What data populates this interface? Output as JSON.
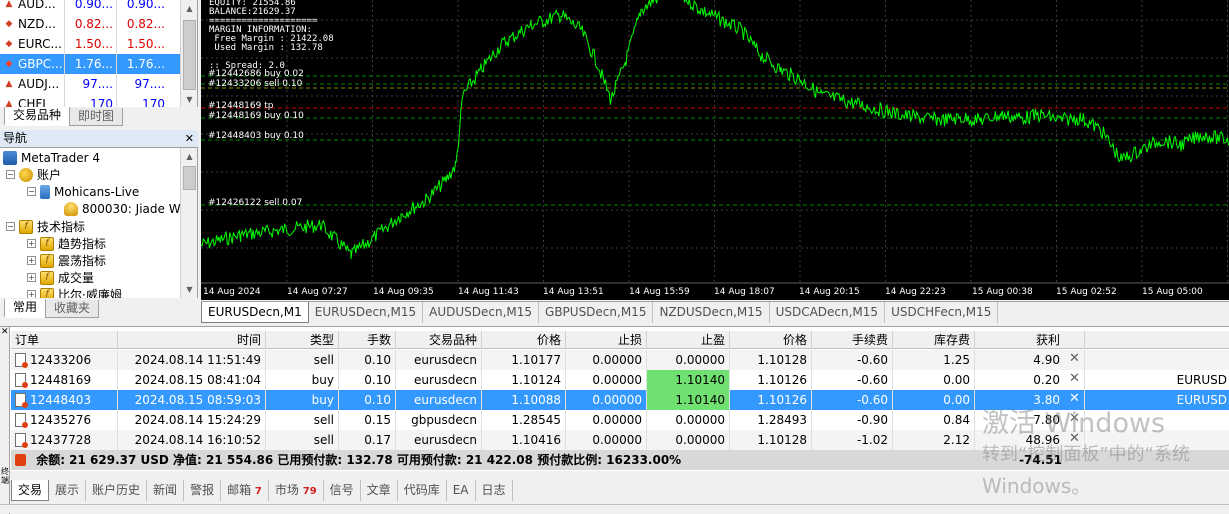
{
  "market_watch": {
    "rows": [
      {
        "symbol": "AUD...",
        "bid": "0.90...",
        "ask": "0.90...",
        "dir": "up"
      },
      {
        "symbol": "NZD...",
        "bid": "0.82...",
        "ask": "0.82...",
        "dir": "down"
      },
      {
        "symbol": "EURC...",
        "bid": "1.50...",
        "ask": "1.50...",
        "dir": "down"
      },
      {
        "symbol": "GBPC...",
        "bid": "1.76...",
        "ask": "1.76...",
        "dir": "down"
      },
      {
        "symbol": "AUDJ...",
        "bid": "97....",
        "ask": "97....",
        "dir": "up"
      },
      {
        "symbol": "CHFJ",
        "bid": "170",
        "ask": "170",
        "dir": "up"
      }
    ],
    "tabs": [
      "交易品种",
      "即时图"
    ]
  },
  "navigator": {
    "title": "导航",
    "items": {
      "root": "MetaTrader 4",
      "accounts": "账户",
      "server": "Mohicans-Live",
      "account": "800030: Jiade W",
      "indicators": "技术指标",
      "trend": "趋势指标",
      "oscillators": "震荡指标",
      "volumes": "成交量",
      "bill_williams": "比尔·威廉姆"
    },
    "tabs": [
      "常用",
      "收藏夹"
    ]
  },
  "chart": {
    "info_text": "EQUITY: 21554.86\nBALANCE:21629.37\n====================\nMARGIN INFORMATION:\n Free Margin : 21422.08\n Used Margin : 132.78\n\n:: Spread: 2.0",
    "order_labels": [
      "#12442686 buy 0.02",
      "#12433206 sell 0.10",
      "#12448169 tp",
      "#12448169 buy 0.10",
      "#12448403 buy 0.10",
      "#12426122 sell 0.07"
    ],
    "x_labels": [
      "14 Aug 2024",
      "14 Aug 07:27",
      "14 Aug 09:35",
      "14 Aug 11:43",
      "14 Aug 13:51",
      "14 Aug 15:59",
      "14 Aug 18:07",
      "14 Aug 20:15",
      "14 Aug 22:23",
      "15 Aug 00:38",
      "15 Aug 02:52",
      "15 Aug 05:00"
    ],
    "tabs": [
      "EURUSDecn,M1",
      "EURUSDecn,M15",
      "AUDUSDecn,M15",
      "GBPUSDecn,M15",
      "NZDUSDecn,M15",
      "USDCADecn,M15",
      "USDCHFecn,M15"
    ],
    "line_color": "#00ff00"
  },
  "terminal": {
    "headers": [
      "订单",
      "时间",
      "类型",
      "手数",
      "交易品种",
      "价格",
      "止损",
      "止盈",
      "价格",
      "手续费",
      "库存费",
      "获利"
    ],
    "rows": [
      {
        "order": "12433206",
        "time": "2024.08.14 11:51:49",
        "type": "sell",
        "lots": "0.10",
        "symbol": "eurusdecn",
        "price": "1.10177",
        "sl": "0.00000",
        "tp": "0.00000",
        "cur": "1.10128",
        "fee": "-0.60",
        "swap": "1.25",
        "profit": "4.90",
        "comment": "",
        "tp_hl": false
      },
      {
        "order": "12448169",
        "time": "2024.08.15 08:41:04",
        "type": "buy",
        "lots": "0.10",
        "symbol": "eurusdecn",
        "price": "1.10124",
        "sl": "0.00000",
        "tp": "1.10140",
        "cur": "1.10126",
        "fee": "-0.60",
        "swap": "0.00",
        "profit": "0.20",
        "comment": "EURUSD",
        "tp_hl": true
      },
      {
        "order": "12448403",
        "time": "2024.08.15 08:59:03",
        "type": "buy",
        "lots": "0.10",
        "symbol": "eurusdecn",
        "price": "1.10088",
        "sl": "0.00000",
        "tp": "1.10140",
        "cur": "1.10126",
        "fee": "-0.60",
        "swap": "0.00",
        "profit": "3.80",
        "comment": "EURUSD",
        "tp_hl": true
      },
      {
        "order": "12435276",
        "time": "2024.08.14 15:24:29",
        "type": "sell",
        "lots": "0.15",
        "symbol": "gbpusdecn",
        "price": "1.28545",
        "sl": "0.00000",
        "tp": "0.00000",
        "cur": "1.28493",
        "fee": "-0.90",
        "swap": "0.84",
        "profit": "7.80",
        "comment": "",
        "tp_hl": false
      },
      {
        "order": "12437728",
        "time": "2024.08.14 16:10:52",
        "type": "sell",
        "lots": "0.17",
        "symbol": "eurusdecn",
        "price": "1.10416",
        "sl": "0.00000",
        "tp": "0.00000",
        "cur": "1.10128",
        "fee": "-1.02",
        "swap": "2.12",
        "profit": "48.96",
        "comment": "",
        "tp_hl": false
      }
    ],
    "summary": "余额: 21 629.37 USD  净值: 21 554.86  已用预付款: 132.78  可用预付款: 21 422.08  预付款比例: 16233.00%",
    "summary_profit": "-74.51",
    "side_label": "终端",
    "tabs": [
      {
        "label": "交易",
        "badge": ""
      },
      {
        "label": "展示",
        "badge": ""
      },
      {
        "label": "账户历史",
        "badge": ""
      },
      {
        "label": "新闻",
        "badge": ""
      },
      {
        "label": "警报",
        "badge": ""
      },
      {
        "label": "邮箱",
        "badge": "7"
      },
      {
        "label": "市场",
        "badge": "79"
      },
      {
        "label": "信号",
        "badge": ""
      },
      {
        "label": "文章",
        "badge": ""
      },
      {
        "label": "代码库",
        "badge": ""
      },
      {
        "label": "EA",
        "badge": ""
      },
      {
        "label": "日志",
        "badge": ""
      }
    ]
  },
  "watermark": {
    "line1": "激活 Windows",
    "line2": "转到“控制面板”中的“系统",
    "line3": "Windows。"
  }
}
